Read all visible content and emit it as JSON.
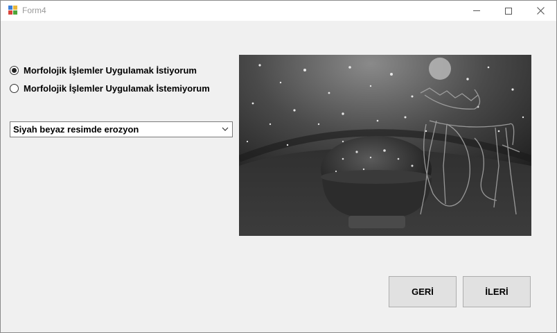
{
  "window": {
    "title": "Form4",
    "icons": {
      "app": "form-app-icon",
      "minimize": "minimize-icon",
      "maximize": "maximize-icon",
      "close": "close-icon"
    }
  },
  "options": {
    "radio_apply": {
      "label": "Morfolojik İşlemler Uygulamak İstiyorum",
      "checked": true
    },
    "radio_not_apply": {
      "label": "Morfolojik İşlemler Uygulamak İstemiyorum",
      "checked": false
    }
  },
  "operation_select": {
    "selected": "Siyah beyaz resimde erozyon",
    "icon": "chevron-down-icon"
  },
  "buttons": {
    "back": "GERİ",
    "next": "İLERİ"
  }
}
